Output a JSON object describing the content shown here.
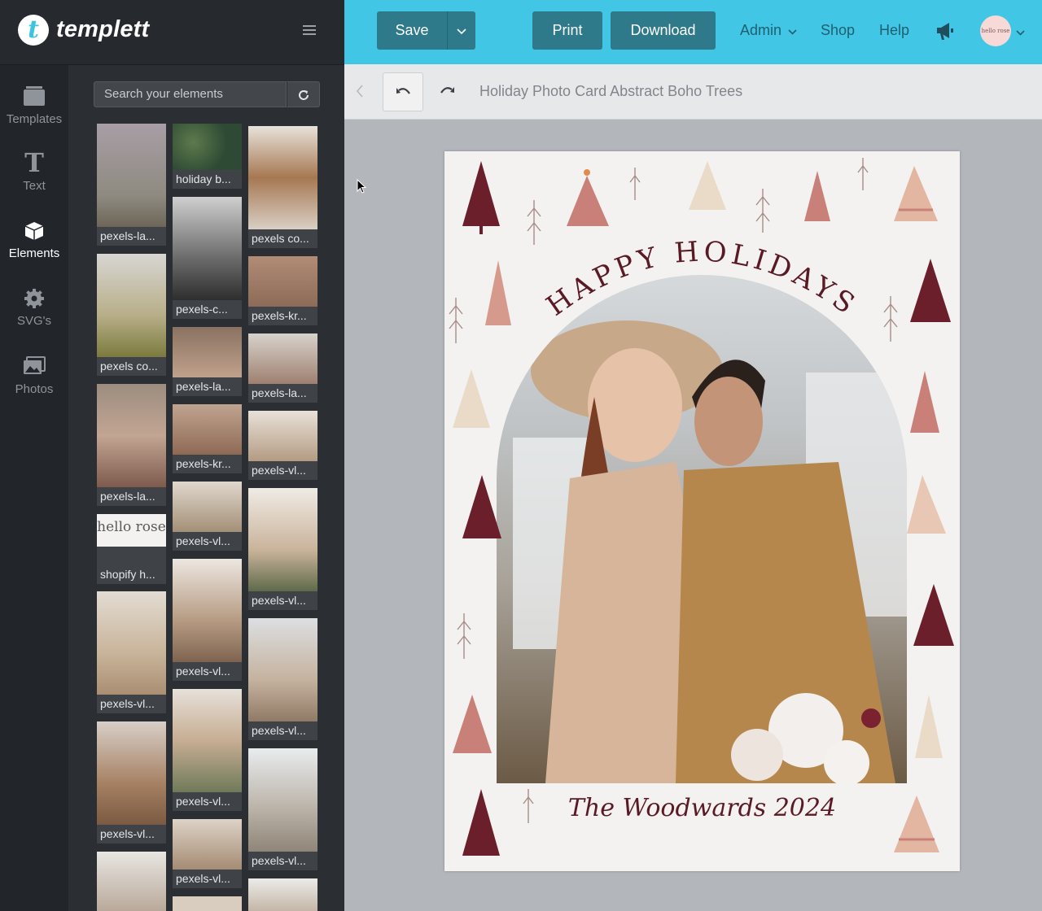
{
  "app": {
    "name": "templett"
  },
  "nav": {
    "items": [
      {
        "label": "Templates",
        "icon": "folder-icon"
      },
      {
        "label": "Text",
        "icon": "text-t-icon"
      },
      {
        "label": "Elements",
        "icon": "cube-icon",
        "active": true
      },
      {
        "label": "SVG's",
        "icon": "gear-icon"
      },
      {
        "label": "Photos",
        "icon": "photos-icon"
      }
    ]
  },
  "search": {
    "placeholder": "Search your elements"
  },
  "elements": {
    "col1": [
      "pexels-la...",
      "pexels co...",
      "pexels-la...",
      "shopify h...",
      "pexels-vl...",
      "pexels-vl..."
    ],
    "col2": [
      "holiday b...",
      "pexels-c...",
      "pexels-la...",
      "pexels-kr...",
      "pexels-vl...",
      "pexels-vl...",
      "pexels-vl...",
      "pexels-vl..."
    ],
    "col3": [
      "pexels co...",
      "pexels-kr...",
      "pexels-la...",
      "pexels-vl...",
      "pexels-vl...",
      "pexels-vl...",
      "pexels-vl..."
    ],
    "logo_text": "hello rose"
  },
  "toolbar": {
    "save_label": "Save",
    "print_label": "Print",
    "download_label": "Download",
    "admin_label": "Admin",
    "shop_label": "Shop",
    "help_label": "Help",
    "avatar_text": "hello rose"
  },
  "document": {
    "title": "Holiday Photo Card Abstract Boho Trees"
  },
  "card": {
    "headline": "HAPPY HOLIDAYS",
    "signature": "The Woodwards 2024"
  },
  "colors": {
    "accent": "#42c6e5",
    "button": "#2e7a8a",
    "card_text": "#5a1a24",
    "tree_maroon": "#6b1f2a",
    "tree_pink": "#c98078"
  }
}
